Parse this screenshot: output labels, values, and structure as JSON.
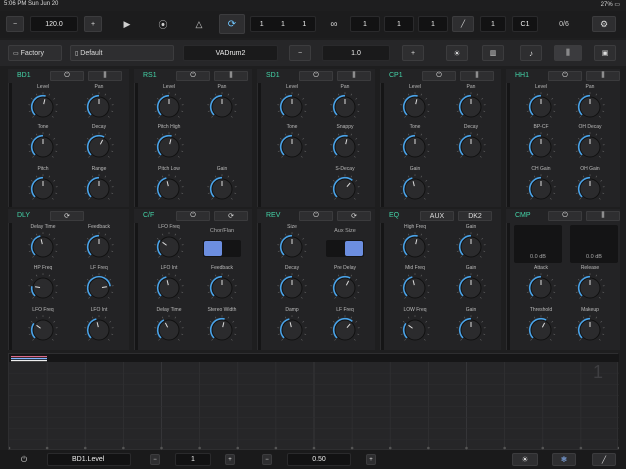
{
  "status": {
    "time": "5:06 PM",
    "date": "Sun Jun 20",
    "battery": "27%"
  },
  "transport": {
    "tempo": "120.0",
    "position": [
      "1",
      "1",
      "1"
    ],
    "loop": [
      "1",
      "1",
      "1"
    ],
    "step": "1",
    "note": "C1",
    "count": "0/6"
  },
  "preset": {
    "bank": "Factory",
    "preset": "Default",
    "kit_name": "VADrum2",
    "value": "1.0"
  },
  "sections": {
    "bd1": {
      "label": "BD1",
      "knobs": [
        "Level",
        "Pan",
        "Tone",
        "Decay",
        "Pitch",
        "Range"
      ],
      "values": [
        0.55,
        0.5,
        0.5,
        0.6,
        0.5,
        0.5
      ]
    },
    "rs1": {
      "label": "RS1",
      "knobs": [
        "Level",
        "Pan",
        "Pitch High",
        "",
        "Pitch Low",
        "Gain"
      ],
      "values": [
        0.5,
        0.5,
        0.55,
        null,
        0.45,
        0.5
      ]
    },
    "sd1": {
      "label": "SD1",
      "knobs": [
        "Level",
        "Pan",
        "Tone",
        "Snappy",
        "",
        "S-Decay"
      ],
      "values": [
        0.5,
        0.5,
        0.5,
        0.55,
        null,
        0.65
      ]
    },
    "cp1": {
      "label": "CP1",
      "knobs": [
        "Level",
        "Pan",
        "Tone",
        "Decay",
        "Gain",
        ""
      ],
      "values": [
        0.55,
        0.5,
        0.5,
        0.5,
        0.45,
        null
      ]
    },
    "hh1": {
      "label": "HH1",
      "knobs": [
        "Level",
        "Pan",
        "BP-CF",
        "OH Decay",
        "CH Gain",
        "OH Gain"
      ],
      "values": [
        0.5,
        0.5,
        0.5,
        0.5,
        0.5,
        0.5
      ]
    },
    "dly": {
      "label": "DLY",
      "knobs": [
        "Delay Time",
        "Feedback",
        "HP Freq",
        "LF Freq",
        "LFO Freq",
        "LFO Int"
      ],
      "values": [
        0.45,
        0.5,
        0.2,
        0.8,
        0.3,
        0.45
      ]
    },
    "cf": {
      "label": "C/F",
      "toggle_label": "Chor/Flan",
      "knobs": [
        "LFO Freq",
        "",
        "LFO Int",
        "Feedback",
        "Delay Time",
        "Stereo Width"
      ],
      "values": [
        0.3,
        null,
        0.45,
        0.5,
        0.4,
        0.55
      ]
    },
    "rev": {
      "label": "REV",
      "toggle_label": "Aux Size",
      "knobs": [
        "Size",
        "",
        "Decay",
        "Pre Delay",
        "Damp",
        "LF Freq"
      ],
      "values": [
        0.5,
        null,
        0.5,
        0.6,
        0.45,
        0.65
      ]
    },
    "eq": {
      "label": "EQ",
      "tabs": [
        "AUX",
        "DK2"
      ],
      "knobs": [
        "High Freq",
        "Gain",
        "Mid Freq",
        "Gain",
        "LOW Freq",
        "Gain"
      ],
      "values": [
        0.55,
        0.5,
        0.45,
        0.5,
        0.3,
        0.5
      ]
    },
    "cmp": {
      "label": "CMP",
      "meters": [
        "0.0 dB",
        "0.0 dB"
      ],
      "knobs": [
        "Attack",
        "Release",
        "Threshold",
        "Makeup"
      ],
      "values": [
        0.5,
        0.5,
        0.6,
        0.5
      ]
    }
  },
  "sequencer": {
    "page_number": "1"
  },
  "bottom": {
    "param": "BD1.Level",
    "step": "1",
    "value": "0.50"
  },
  "colors": {
    "accent": "#44d4a8",
    "knob_arc": "#4aa3e8",
    "toggle": "#6c8ee0"
  }
}
